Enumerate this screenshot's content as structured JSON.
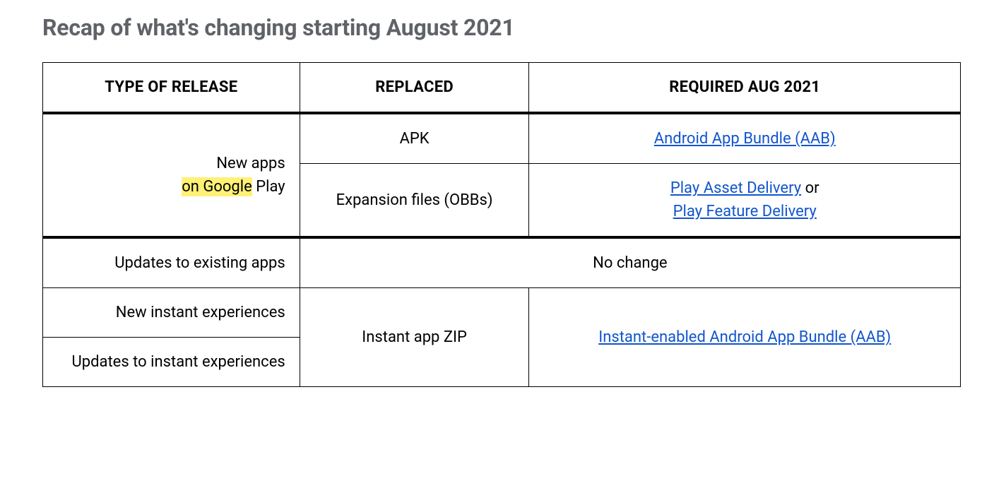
{
  "heading": "Recap of what's changing starting August 2021",
  "table": {
    "headers": {
      "type": "TYPE OF RELEASE",
      "replaced": "REPLACED",
      "required": "REQUIRED AUG 2021"
    },
    "rows": {
      "new_apps": {
        "type_line1": "New apps",
        "type_prefix": "on Google",
        "type_suffix": " Play",
        "row1_replaced": "APK",
        "row1_required_link": "Android App Bundle (AAB)",
        "row2_replaced": "Expansion files (OBBs)",
        "row2_required_link1": "Play Asset Delivery",
        "row2_required_mid": " or ",
        "row2_required_link2": "Play Feature Delivery"
      },
      "updates_existing": {
        "type": "Updates to existing apps",
        "merged": "No change"
      },
      "instant": {
        "type_new": "New instant experiences",
        "type_updates": "Updates to instant experiences",
        "replaced": "Instant app ZIP",
        "required_link": "Instant-enabled Android App Bundle (AAB)"
      }
    }
  }
}
